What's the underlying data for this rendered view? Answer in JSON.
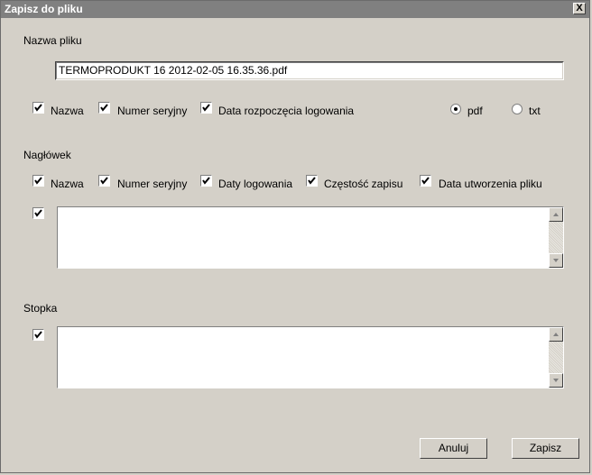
{
  "window": {
    "title": "Zapisz do pliku",
    "close_label": "X"
  },
  "filename": {
    "label": "Nazwa pliku",
    "value": "TERMOPRODUKT 16 2012-02-05 16.35.36.pdf"
  },
  "file_options": [
    {
      "label": "Nazwa",
      "checked": true
    },
    {
      "label": "Numer seryjny",
      "checked": true
    },
    {
      "label": "Data rozpoczęcia logowania",
      "checked": true
    }
  ],
  "format": [
    {
      "label": "pdf",
      "selected": true
    },
    {
      "label": "txt",
      "selected": false
    }
  ],
  "header": {
    "label": "Nagłówek",
    "options": [
      {
        "label": "Nazwa",
        "checked": true
      },
      {
        "label": "Numer seryjny",
        "checked": true
      },
      {
        "label": "Daty logowania",
        "checked": true
      },
      {
        "label": "Częstość zapisu",
        "checked": true
      },
      {
        "label": "Data utworzenia pliku",
        "checked": true
      }
    ],
    "custom_enabled": true,
    "custom_text": ""
  },
  "footer": {
    "label": "Stopka",
    "custom_enabled": true,
    "custom_text": ""
  },
  "buttons": {
    "cancel": "Anuluj",
    "save": "Zapisz"
  }
}
